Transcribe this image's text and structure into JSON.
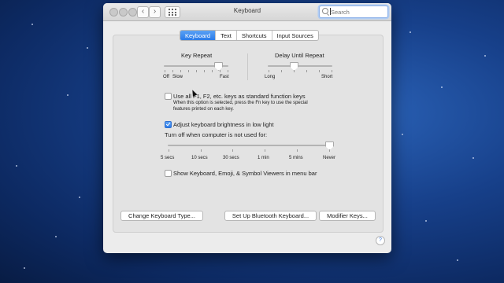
{
  "window": {
    "title": "Keyboard"
  },
  "toolbar": {
    "back_icon": "chevron-left-icon",
    "forward_icon": "chevron-right-icon",
    "grid_icon": "grid-icon"
  },
  "search": {
    "placeholder": "Search",
    "icon": "magnifier-icon"
  },
  "tabs": [
    {
      "label": "Keyboard",
      "active": true
    },
    {
      "label": "Text",
      "active": false
    },
    {
      "label": "Shortcuts",
      "active": false
    },
    {
      "label": "Input Sources",
      "active": false
    }
  ],
  "key_repeat": {
    "title": "Key Repeat",
    "min_label": "Off",
    "slow_label": "Slow",
    "max_label": "Fast",
    "level": 0.85
  },
  "delay_until_repeat": {
    "title": "Delay Until Repeat",
    "min_label": "Long",
    "max_label": "Short",
    "level": 0.4
  },
  "options": {
    "function_keys": {
      "checked": false,
      "label": "Use all F1, F2, etc. keys as standard function keys",
      "note_line1": "When this option is selected, press the Fn key to use the special",
      "note_line2": "features printed on each key."
    },
    "brightness": {
      "checked": true,
      "label": "Adjust keyboard brightness in low light"
    },
    "viewers": {
      "checked": false,
      "label": "Show Keyboard, Emoji, & Symbol Viewers in menu bar"
    }
  },
  "turn_off": {
    "title": "Turn off when computer is not used for:",
    "ticks": [
      "5 secs",
      "10 secs",
      "30 secs",
      "1 min",
      "5 mins",
      "Never"
    ],
    "level": 1.0
  },
  "buttons": {
    "change_type": "Change Keyboard Type...",
    "bluetooth": "Set Up Bluetooth Keyboard...",
    "modifier": "Modifier Keys..."
  },
  "help": {
    "label": "?"
  },
  "colors": {
    "accent": "#2b7be9",
    "desktop": "#17408a"
  }
}
